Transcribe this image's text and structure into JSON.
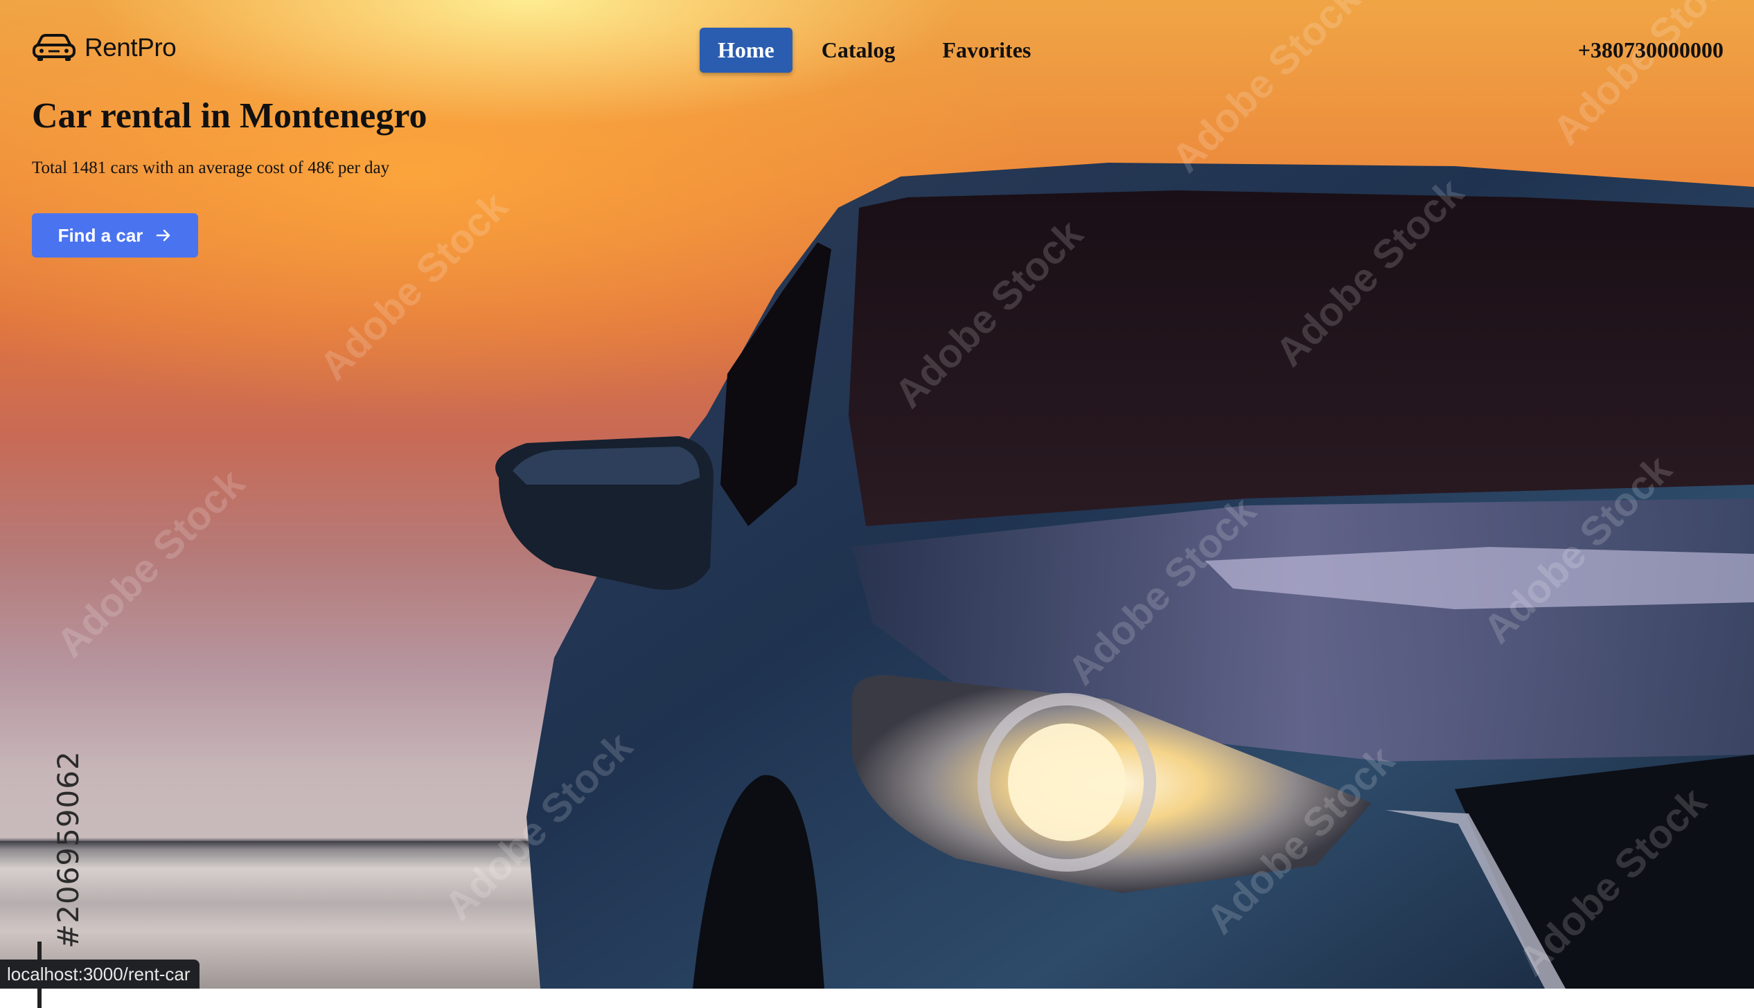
{
  "brand": {
    "name": "RentPro",
    "icon": "car-icon"
  },
  "nav": {
    "items": [
      {
        "label": "Home",
        "active": true
      },
      {
        "label": "Catalog",
        "active": false
      },
      {
        "label": "Favorites",
        "active": false
      }
    ]
  },
  "contact": {
    "phone": "+380730000000"
  },
  "hero": {
    "title": "Car rental in Montenegro",
    "subtitle": "Total 1481 cars with an average cost of 48€ per day",
    "cta_label": "Find a car",
    "cta_icon": "arrow-right-icon"
  },
  "watermark": {
    "text": "Adobe Stock",
    "id": "#206959062"
  },
  "status_bar": {
    "url": "localhost:3000/rent-car"
  },
  "colors": {
    "accent": "#2a5db0",
    "cta": "#4a73f0"
  }
}
